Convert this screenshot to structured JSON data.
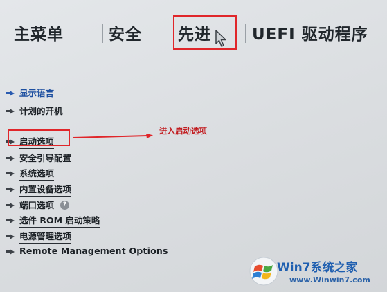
{
  "tabs": [
    {
      "label": "主菜单"
    },
    {
      "label": "安全"
    },
    {
      "label": "先进"
    },
    {
      "label": "UEFI 驱动程序"
    }
  ],
  "menu": {
    "items": [
      {
        "label": "显示语言"
      },
      {
        "label": "计划的开机"
      },
      {
        "label": "启动选项"
      },
      {
        "label": "安全引导配置"
      },
      {
        "label": "系统选项"
      },
      {
        "label": "内置设备选项"
      },
      {
        "label": "端口选项"
      },
      {
        "label": "选件 ROM 启动策略"
      },
      {
        "label": "电源管理选项"
      },
      {
        "label": "Remote Management Options"
      }
    ],
    "help_glyph": "?"
  },
  "annotation": {
    "text": "进入启动选项",
    "color": "#e0262a"
  },
  "watermark": {
    "title": "Win7系统之家",
    "url": "www.Winwin7.com"
  },
  "icons": {
    "item_bullet": "right-arrow-icon",
    "help": "help-icon",
    "pointer": "mouse-cursor-icon",
    "logo": "windows-logo-icon"
  }
}
